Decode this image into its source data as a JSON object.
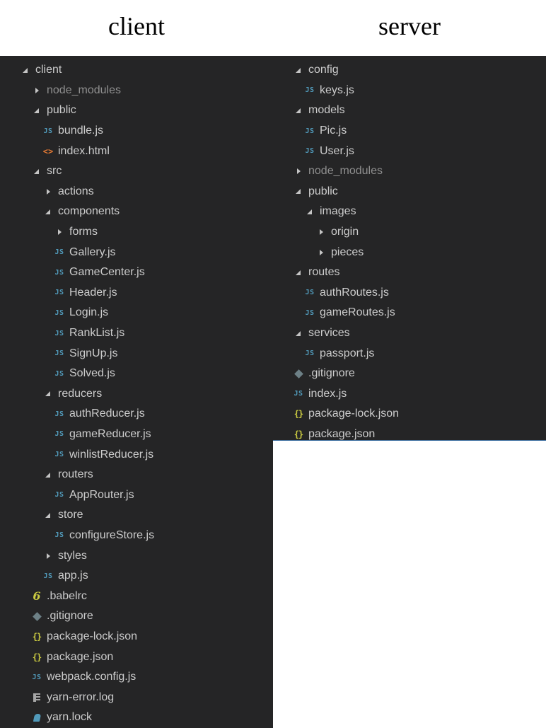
{
  "headings": {
    "client": "client",
    "server": "server"
  },
  "client_tree": [
    {
      "label": "client",
      "type": "folder",
      "open": true,
      "depth": 0
    },
    {
      "label": "node_modules",
      "type": "folder",
      "open": false,
      "depth": 1,
      "dim": true
    },
    {
      "label": "public",
      "type": "folder",
      "open": true,
      "depth": 1
    },
    {
      "label": "bundle.js",
      "type": "js",
      "depth": 2
    },
    {
      "label": "index.html",
      "type": "html",
      "depth": 2
    },
    {
      "label": "src",
      "type": "folder",
      "open": true,
      "depth": 1
    },
    {
      "label": "actions",
      "type": "folder",
      "open": false,
      "depth": 2
    },
    {
      "label": "components",
      "type": "folder",
      "open": true,
      "depth": 2
    },
    {
      "label": "forms",
      "type": "folder",
      "open": false,
      "depth": 3
    },
    {
      "label": "Gallery.js",
      "type": "js",
      "depth": 3
    },
    {
      "label": "GameCenter.js",
      "type": "js",
      "depth": 3
    },
    {
      "label": "Header.js",
      "type": "js",
      "depth": 3
    },
    {
      "label": "Login.js",
      "type": "js",
      "depth": 3
    },
    {
      "label": "RankList.js",
      "type": "js",
      "depth": 3
    },
    {
      "label": "SignUp.js",
      "type": "js",
      "depth": 3
    },
    {
      "label": "Solved.js",
      "type": "js",
      "depth": 3
    },
    {
      "label": "reducers",
      "type": "folder",
      "open": true,
      "depth": 2
    },
    {
      "label": "authReducer.js",
      "type": "js",
      "depth": 3
    },
    {
      "label": "gameReducer.js",
      "type": "js",
      "depth": 3
    },
    {
      "label": "winlistReducer.js",
      "type": "js",
      "depth": 3
    },
    {
      "label": "routers",
      "type": "folder",
      "open": true,
      "depth": 2
    },
    {
      "label": "AppRouter.js",
      "type": "js",
      "depth": 3
    },
    {
      "label": "store",
      "type": "folder",
      "open": true,
      "depth": 2
    },
    {
      "label": "configureStore.js",
      "type": "js",
      "depth": 3
    },
    {
      "label": "styles",
      "type": "folder",
      "open": false,
      "depth": 2
    },
    {
      "label": "app.js",
      "type": "js",
      "depth": 2
    },
    {
      "label": ".babelrc",
      "type": "babel",
      "depth": 1
    },
    {
      "label": ".gitignore",
      "type": "git",
      "depth": 1
    },
    {
      "label": "package-lock.json",
      "type": "json",
      "depth": 1
    },
    {
      "label": "package.json",
      "type": "json",
      "depth": 1
    },
    {
      "label": "webpack.config.js",
      "type": "js",
      "depth": 1
    },
    {
      "label": "yarn-error.log",
      "type": "log",
      "depth": 1
    },
    {
      "label": "yarn.lock",
      "type": "yarn",
      "depth": 1
    }
  ],
  "server_tree": [
    {
      "label": "config",
      "type": "folder",
      "open": true,
      "depth": 0
    },
    {
      "label": "keys.js",
      "type": "js",
      "depth": 1
    },
    {
      "label": "models",
      "type": "folder",
      "open": true,
      "depth": 0
    },
    {
      "label": "Pic.js",
      "type": "js",
      "depth": 1
    },
    {
      "label": "User.js",
      "type": "js",
      "depth": 1
    },
    {
      "label": "node_modules",
      "type": "folder",
      "open": false,
      "depth": 0,
      "dim": true
    },
    {
      "label": "public",
      "type": "folder",
      "open": true,
      "depth": 0
    },
    {
      "label": "images",
      "type": "folder",
      "open": true,
      "depth": 1
    },
    {
      "label": "origin",
      "type": "folder",
      "open": false,
      "depth": 2
    },
    {
      "label": "pieces",
      "type": "folder",
      "open": false,
      "depth": 2
    },
    {
      "label": "routes",
      "type": "folder",
      "open": true,
      "depth": 0
    },
    {
      "label": "authRoutes.js",
      "type": "js",
      "depth": 1
    },
    {
      "label": "gameRoutes.js",
      "type": "js",
      "depth": 1
    },
    {
      "label": "services",
      "type": "folder",
      "open": true,
      "depth": 0
    },
    {
      "label": "passport.js",
      "type": "js",
      "depth": 1
    },
    {
      "label": ".gitignore",
      "type": "git",
      "depth": 0
    },
    {
      "label": "index.js",
      "type": "js",
      "depth": 0
    },
    {
      "label": "package-lock.json",
      "type": "json",
      "depth": 0
    },
    {
      "label": "package.json",
      "type": "json",
      "depth": 0
    }
  ],
  "icons": {
    "js": "JS",
    "html": "<>",
    "json": "{}",
    "babel": "6"
  },
  "colors": {
    "panel_bg": "#252526",
    "text": "#cccccc",
    "js": "#519aba",
    "html": "#e37933",
    "json": "#cbcb41",
    "git": "#6d8086"
  }
}
